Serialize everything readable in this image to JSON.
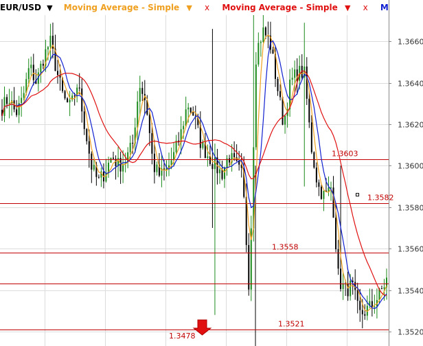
{
  "legend": {
    "symbol": "EUR/USD",
    "symbol_arrow": "▼",
    "indicators": [
      {
        "label": "Moving Average - Simple",
        "arrow": "▼",
        "close": "x",
        "color": "#f0a020"
      },
      {
        "label": "Moving Average - Simple",
        "arrow": "▼",
        "close": "x",
        "color": "#e01010"
      },
      {
        "label": "Moving A",
        "arrow": "",
        "close": "",
        "color": "#1020d0"
      }
    ]
  },
  "colors": {
    "up_bar": "#1a8a1a",
    "down_bar": "#000000",
    "ma_fast": "#f0a020",
    "ma_mid": "#1020d0",
    "ma_slow": "#e01010",
    "level_line": "#c00000",
    "level_text": "#c00000",
    "grid": "#dcdcdc",
    "axis_text": "#333333"
  },
  "chart_data": {
    "type": "candlestick",
    "title": "",
    "symbol": "EUR/USD",
    "ylim": [
      1.3513,
      1.3676
    ],
    "y_ticks": [
      "1.3660",
      "1.3640",
      "1.3620",
      "1.3600",
      "1.3580",
      "1.3560",
      "1.3540",
      "1.3520"
    ],
    "grid": true,
    "horizontal_levels": [
      {
        "price": 1.3603,
        "label": "1.3603"
      },
      {
        "price": 1.3582,
        "label": "1.3582"
      },
      {
        "price": 1.3558,
        "label": "1.3558"
      },
      {
        "price": 1.3543,
        "label": ""
      },
      {
        "price": 1.3521,
        "label": "1.3521"
      }
    ],
    "off_chart_marker": {
      "price": 1.3478,
      "label": "1.3478",
      "direction": "down"
    },
    "price_anchors": [
      1.3628,
      1.3633,
      1.3625,
      1.3632,
      1.3648,
      1.364,
      1.3652,
      1.366,
      1.3645,
      1.3632,
      1.3628,
      1.364,
      1.362,
      1.36,
      1.3592,
      1.3597,
      1.3605,
      1.36,
      1.3603,
      1.361,
      1.364,
      1.363,
      1.36,
      1.3595,
      1.3598,
      1.3605,
      1.3615,
      1.363,
      1.3624,
      1.361,
      1.3605,
      1.36,
      1.3596,
      1.3605,
      1.36,
      1.3595,
      1.354,
      1.3655,
      1.3665,
      1.366,
      1.364,
      1.362,
      1.364,
      1.3645,
      1.3645,
      1.361,
      1.359,
      1.3585,
      1.359,
      1.3545,
      1.354,
      1.3542,
      1.3528,
      1.353,
      1.3533,
      1.3538,
      1.3545
    ],
    "series": [
      {
        "name": "Moving Average - Simple",
        "color": "#f0a020"
      },
      {
        "name": "Moving Average - Simple",
        "color": "#e01010"
      },
      {
        "name": "Moving A",
        "color": "#1020d0"
      }
    ]
  }
}
